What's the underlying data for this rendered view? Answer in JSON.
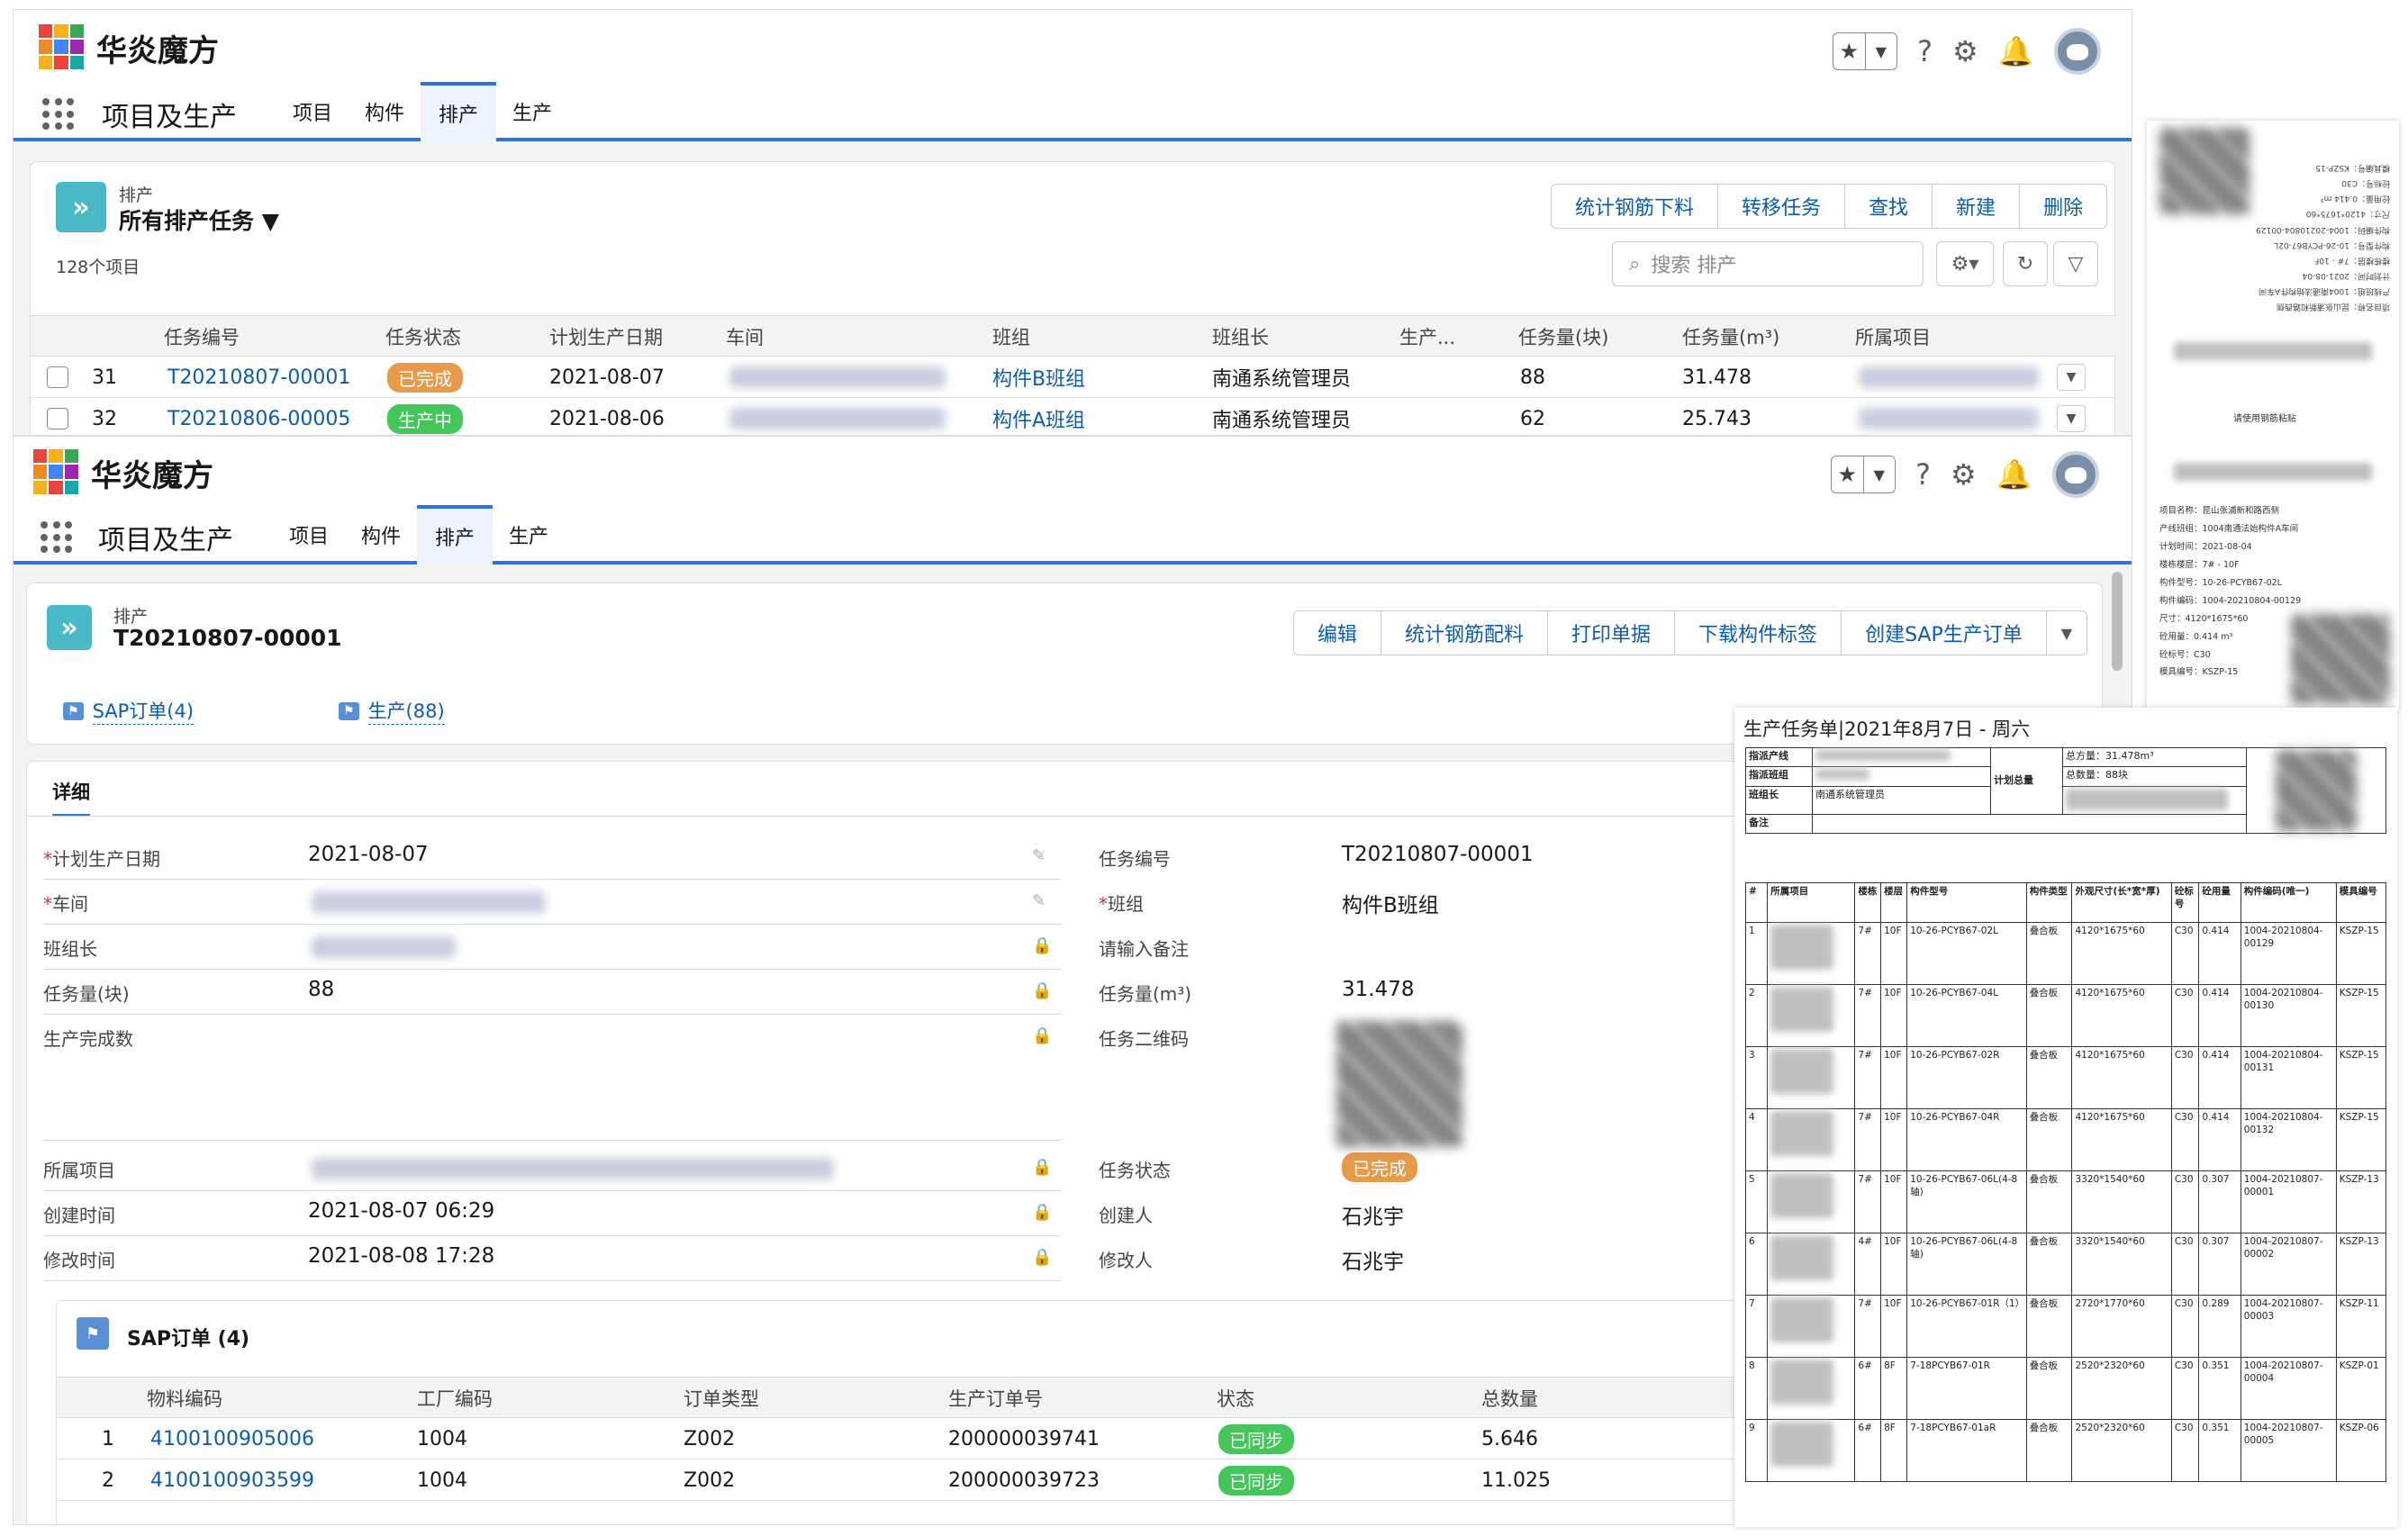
{
  "brand": "华炎魔方",
  "app_name": "项目及生产",
  "nav_tabs": [
    "项目",
    "构件",
    "排产",
    "生产"
  ],
  "list_view": {
    "object_label": "排产",
    "view_name": "所有排产任务",
    "count_text": "128个项目",
    "buttons": [
      "统计钢筋下料",
      "转移任务",
      "查找",
      "新建",
      "删除"
    ],
    "search_placeholder": "搜索 排产",
    "columns": [
      "任务编号",
      "任务状态",
      "计划生产日期",
      "车间",
      "班组",
      "班组长",
      "生产...",
      "任务量(块)",
      "任务量(m³)",
      "所属项目"
    ],
    "rows": [
      {
        "num": "31",
        "task_no": "T20210807-00001",
        "status": "已完成",
        "date": "2021-08-07",
        "team": "构件B班组",
        "leader": "南通系统管理员",
        "qty": "88",
        "vol": "31.478"
      },
      {
        "num": "32",
        "task_no": "T20210806-00005",
        "status": "生产中",
        "date": "2021-08-06",
        "team": "构件A班组",
        "leader": "南通系统管理员",
        "qty": "62",
        "vol": "25.743"
      }
    ]
  },
  "detail": {
    "object_label": "排产",
    "record_title": "T20210807-00001",
    "buttons": [
      "编辑",
      "统计钢筋配料",
      "打印单据",
      "下载构件标签",
      "创建SAP生产订单"
    ],
    "related_links": [
      "SAP订单(4)",
      "生产(88)"
    ],
    "tab": "详细",
    "left_fields": [
      {
        "label": "计划生产日期",
        "value": "2021-08-07",
        "required": "*"
      },
      {
        "label": "车间",
        "value": "",
        "required": "*"
      },
      {
        "label": "班组长",
        "value": "",
        "required": ""
      },
      {
        "label": "任务量(块)",
        "value": "88",
        "required": ""
      },
      {
        "label": "生产完成数",
        "value": "",
        "required": ""
      },
      {
        "label": "所属项目",
        "value": "",
        "required": ""
      },
      {
        "label": "创建时间",
        "value": "2021-08-07 06:29",
        "required": ""
      },
      {
        "label": "修改时间",
        "value": "2021-08-08 17:28",
        "required": ""
      }
    ],
    "right_fields": [
      {
        "label": "任务编号",
        "value": "T20210807-00001",
        "required": ""
      },
      {
        "label": "班组",
        "value": "构件B班组",
        "required": "*"
      },
      {
        "label": "请输入备注",
        "value": "",
        "required": ""
      },
      {
        "label": "任务量(m³)",
        "value": "31.478",
        "required": ""
      },
      {
        "label": "任务二维码",
        "value": "",
        "required": ""
      },
      {
        "label": "任务状态",
        "value": "已完成",
        "required": ""
      },
      {
        "label": "创建人",
        "value": "石兆宇",
        "required": ""
      },
      {
        "label": "修改人",
        "value": "石兆宇",
        "required": ""
      }
    ],
    "sap_section": {
      "title": "SAP订单 (4)",
      "columns": [
        "物料编码",
        "工厂编码",
        "订单类型",
        "生产订单号",
        "状态",
        "总数量"
      ],
      "rows": [
        {
          "num": "1",
          "material": "4100100905006",
          "plant": "1004",
          "type": "Z002",
          "order": "200000039741",
          "status": "已同步",
          "total": "5.646"
        },
        {
          "num": "2",
          "material": "4100100903599",
          "plant": "1004",
          "type": "Z002",
          "order": "200000039723",
          "status": "已同步",
          "total": "11.025"
        }
      ]
    }
  },
  "label_sheet": {
    "center_text": "请使用钢筋粘贴",
    "lines": [
      "项目名称：昆山张浦新和路西侧",
      "产线班组：1004南通法始构件A车间",
      "计划时间：2021-08-04",
      "楼栋楼层：7# - 10F",
      "构件型号：10-26-PCYB67-02L",
      "构件编码：1004-20210804-00129",
      "尺寸：4120*1675*60",
      "砼用量：0.414 m³",
      "砼标号：C30",
      "模具编号：KSZP-15"
    ]
  },
  "task_sheet": {
    "title": "生产任务单|2021年8月7日 - 周六",
    "header_labels": [
      "指派产线",
      "指派班组",
      "班组长",
      "备注",
      "计划总量"
    ],
    "leader": "南通系统管理员",
    "total_volume": "总方量：31.478m³",
    "total_count": "总数量：88块",
    "columns": [
      "#",
      "所属项目",
      "楼栋",
      "楼层",
      "构件型号",
      "构件类型",
      "外观尺寸(长*宽*厚)",
      "砼标号",
      "砼用量",
      "构件编码(唯一)",
      "模具编号"
    ],
    "rows": [
      [
        "1",
        "7#",
        "10F",
        "10-26-PCYB67-02L",
        "叠合板",
        "4120*1675*60",
        "C30",
        "0.414",
        "1004-20210804-00129",
        "KSZP-15"
      ],
      [
        "2",
        "7#",
        "10F",
        "10-26-PCYB67-04L",
        "叠合板",
        "4120*1675*60",
        "C30",
        "0.414",
        "1004-20210804-00130",
        "KSZP-15"
      ],
      [
        "3",
        "7#",
        "10F",
        "10-26-PCYB67-02R",
        "叠合板",
        "4120*1675*60",
        "C30",
        "0.414",
        "1004-20210804-00131",
        "KSZP-15"
      ],
      [
        "4",
        "7#",
        "10F",
        "10-26-PCYB67-04R",
        "叠合板",
        "4120*1675*60",
        "C30",
        "0.414",
        "1004-20210804-00132",
        "KSZP-15"
      ],
      [
        "5",
        "7#",
        "10F",
        "10-26-PCYB67-06L(4-8轴)",
        "叠合板",
        "3320*1540*60",
        "C30",
        "0.307",
        "1004-20210807-00001",
        "KSZP-13"
      ],
      [
        "6",
        "4#",
        "10F",
        "10-26-PCYB67-06L(4-8轴)",
        "叠合板",
        "3320*1540*60",
        "C30",
        "0.307",
        "1004-20210807-00002",
        "KSZP-13"
      ],
      [
        "7",
        "7#",
        "10F",
        "10-26-PCYB67-01R（1）",
        "叠合板",
        "2720*1770*60",
        "C30",
        "0.289",
        "1004-20210807-00003",
        "KSZP-11"
      ],
      [
        "8",
        "6#",
        "8F",
        "7-18PCYB67-01R",
        "叠合板",
        "2520*2320*60",
        "C30",
        "0.351",
        "1004-20210807-00004",
        "KSZP-01"
      ],
      [
        "9",
        "6#",
        "8F",
        "7-18PCYB67-01aR",
        "叠合板",
        "2520*2320*60",
        "C30",
        "0.351",
        "1004-20210807-00005",
        "KSZP-06"
      ]
    ]
  }
}
